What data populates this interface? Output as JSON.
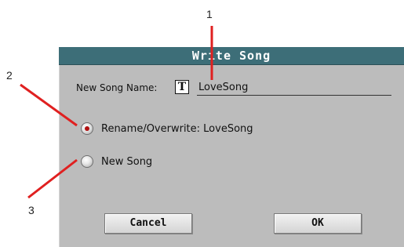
{
  "dialog": {
    "title": "Write Song",
    "name_label": "New Song Name:",
    "text_icon": "T",
    "name_value": "LoveSong",
    "options": [
      {
        "label": "Rename/Overwrite: LoveSong",
        "selected": true
      },
      {
        "label": "New Song",
        "selected": false
      }
    ],
    "cancel_label": "Cancel",
    "ok_label": "OK"
  },
  "callouts": [
    "1",
    "2",
    "3"
  ],
  "colors": {
    "title_bar": "#3d6e78",
    "dialog_bg": "#bcbcbc",
    "callout_line": "#e02020",
    "radio_selected": "#b11010"
  },
  "icons": {
    "text_edit": "text-edit-icon"
  }
}
